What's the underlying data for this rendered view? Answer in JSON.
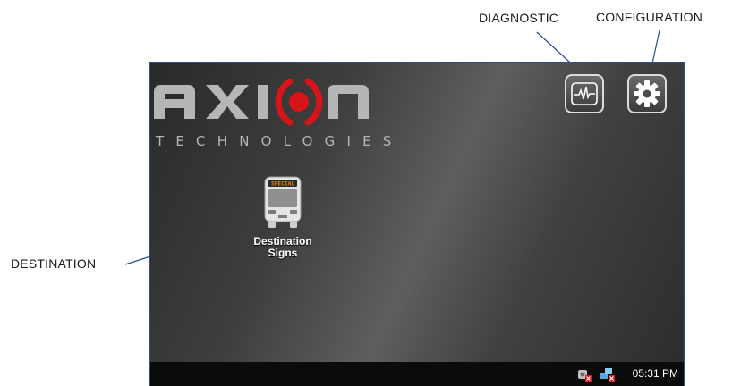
{
  "callouts": {
    "diagnostic": "DIAGNOSTIC",
    "configuration": "CONFIGURATION",
    "destination": "DESTINATION"
  },
  "logo": {
    "word": "AXION",
    "subtitle": "TECHNOLOGIES",
    "accent_color": "#d8141b"
  },
  "toolbar": {
    "diagnostic_icon": "heartbeat-icon",
    "configuration_icon": "gear-icon"
  },
  "apps": [
    {
      "label_line1": "Destination",
      "label_line2": "Signs",
      "icon": "bus-icon",
      "sign_text": "SPECIAL"
    }
  ],
  "taskbar": {
    "tray_icons": [
      "network-disconnected-icon",
      "connection-error-icon"
    ],
    "clock": "05:31 PM"
  },
  "colors": {
    "screen_border": "#2c4f8a",
    "taskbar": "#0b0b0b",
    "sign_text": "#e38a00"
  }
}
